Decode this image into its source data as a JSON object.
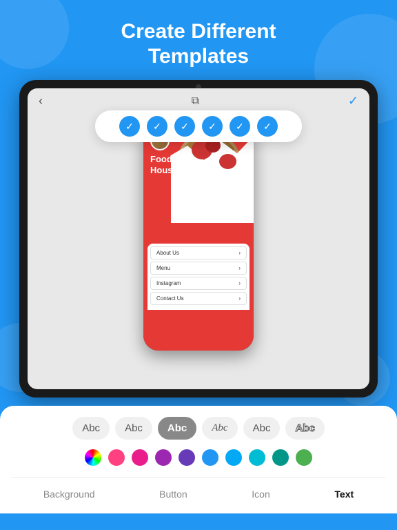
{
  "header": {
    "title": "Create Different\nTemplates"
  },
  "tablet": {
    "nav": {
      "back": "‹",
      "check": "✓"
    }
  },
  "icon_selector": {
    "items": [
      "✓",
      "✓",
      "✓",
      "✓",
      "✓",
      "✓"
    ]
  },
  "phone": {
    "brand": "Food\nHouse",
    "menu_items": [
      {
        "label": "About Us",
        "arrow": ">"
      },
      {
        "label": "Menu",
        "arrow": ">"
      },
      {
        "label": "Instagram",
        "arrow": ">"
      },
      {
        "label": "Contact Us",
        "arrow": ">"
      }
    ]
  },
  "font_selector": {
    "options": [
      {
        "label": "Abc",
        "style": "normal",
        "active": false
      },
      {
        "label": "Abc",
        "style": "normal",
        "active": false
      },
      {
        "label": "Abc",
        "style": "bold",
        "active": true
      },
      {
        "label": "Abc",
        "style": "italic",
        "active": false
      },
      {
        "label": "Abc",
        "style": "light",
        "active": false
      },
      {
        "label": "Abc",
        "style": "outline",
        "active": false
      }
    ]
  },
  "colors": [
    {
      "name": "rainbow",
      "value": "rainbow"
    },
    {
      "name": "hot-pink",
      "value": "#FF4081"
    },
    {
      "name": "pink",
      "value": "#E91E8C"
    },
    {
      "name": "purple",
      "value": "#9C27B0"
    },
    {
      "name": "deep-purple",
      "value": "#673AB7"
    },
    {
      "name": "blue",
      "value": "#2196F3"
    },
    {
      "name": "light-blue",
      "value": "#03A9F4"
    },
    {
      "name": "cyan",
      "value": "#00BCD4"
    },
    {
      "name": "teal",
      "value": "#009688"
    },
    {
      "name": "green",
      "value": "#4CAF50"
    }
  ],
  "tabs": [
    {
      "label": "Background",
      "active": false
    },
    {
      "label": "Button",
      "active": false
    },
    {
      "label": "Icon",
      "active": false
    },
    {
      "label": "Text",
      "active": true
    }
  ]
}
